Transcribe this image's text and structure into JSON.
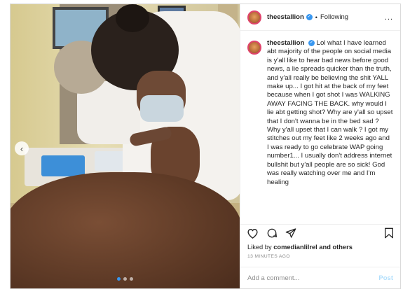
{
  "post": {
    "username": "theestallion",
    "follow_label": "Following",
    "separator": "•",
    "more_label": "...",
    "caption_username": "theestallion",
    "caption": "Lol what I have learned abt majority of the people on social media is y'all like to hear bad news before good news, a lie spreads quicker than the truth, and y'all really be believing the shit YALL make up... I got hit at the back of my feet because when I got shot I was WALKING AWAY FACING THE BACK. why would I lie abt getting shot? Why are y'all so upset that I don't wanna be in the bed sad ? Why y'all upset that I can walk ? I got my stitches out my feet like 2 weeks ago and I was ready to go celebrate WAP going number1... I usually don't address internet bullshit but y'all people are so sick! God was really watching over me and I'm healing",
    "liked_by_prefix": "Liked by",
    "liked_by_user": "comedianlilrel",
    "liked_by_suffix": "and others",
    "timestamp": "13 MINUTES AGO",
    "comment_placeholder": "Add a comment...",
    "post_label": "Post"
  },
  "carousel": {
    "prev_arrow": "‹",
    "slides_total": 3,
    "active_slide": 1
  },
  "icons": {
    "like": "heart-icon",
    "comment": "comment-icon",
    "share": "share-icon",
    "save": "bookmark-icon",
    "verified": "verified-badge-icon"
  },
  "colors": {
    "verified": "#3897f0",
    "post_button": "#b2dffc",
    "timestamp": "#8e8e8e"
  }
}
